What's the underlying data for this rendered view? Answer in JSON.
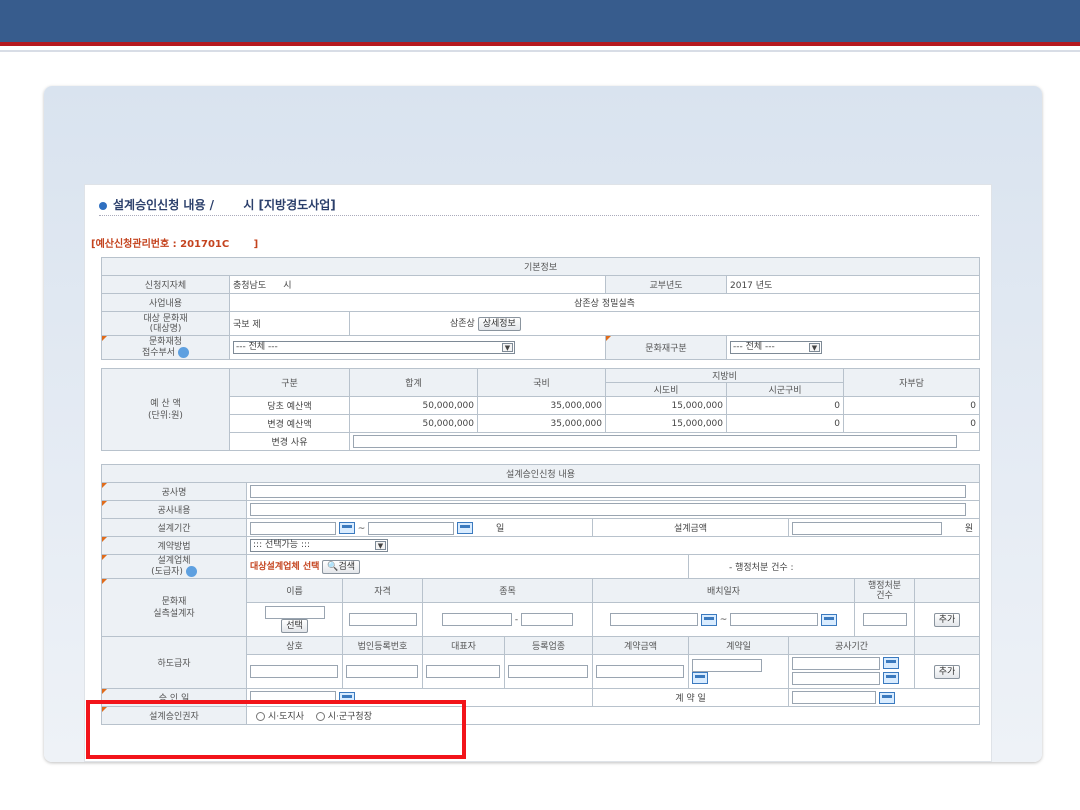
{
  "heading": {
    "title": "설계승인신청 내용 /",
    "region": "시 [지방경도사업]"
  },
  "mgmt": {
    "label": "[예산신청관리번호 : ",
    "number": "201701C",
    "close": "]"
  },
  "basic": {
    "section": "기본정보",
    "applicant_label": "신청지자체",
    "applicant_value": "충청남도",
    "applicant_city": "시",
    "year_label": "교부년도",
    "year_value": "2017 년도",
    "project_label": "사업내용",
    "project_value": "삼존상 정밀실측",
    "heritage_label": "대상 문화재\n(대상명)",
    "heritage_value": "국보 제",
    "heritage_name": "삼존상",
    "detail_button": "상세정보",
    "office_label": "문화재청\n접수부서",
    "office_select": "--- 전체 ---",
    "category_label": "문화재구분",
    "category_select": "--- 전체 ---",
    "budget_label": "예 산 액\n(단위:원)",
    "budget_headers": {
      "type": "구분",
      "total": "합계",
      "national": "국비",
      "local": "지방비",
      "provincial": "시도비",
      "city": "시군구비",
      "self": "자부담"
    },
    "budget_rows": [
      {
        "type": "당초 예산액",
        "total": "50,000,000",
        "national": "35,000,000",
        "provincial": "15,000,000",
        "city": "0",
        "self": "0"
      },
      {
        "type": "변경 예산액",
        "total": "50,000,000",
        "national": "35,000,000",
        "provincial": "15,000,000",
        "city": "0",
        "self": "0"
      }
    ],
    "change_reason_label": "변경 사유"
  },
  "design": {
    "section": "설계승인신청 내용",
    "work_name": "공사명",
    "work_content": "공사내용",
    "period_label": "설계기간",
    "period_sep": "~",
    "period_unit": "일",
    "amount_label": "설계금액",
    "amount_unit": "원",
    "contract_method": "계약방법",
    "contract_select": "::: 선택가능 :::",
    "designer_label": "설계업체\n(도급자)",
    "designer_select": "대상설계업체 선택",
    "search_button": "검색",
    "disposal_count": "- 행정처분 건수 :",
    "surveyor_label": "문화재\n실측설계자",
    "surveyor_headers": {
      "name": "이름",
      "qual": "자격",
      "type": "종목",
      "period": "배치일자",
      "disposal": "행정처분\n건수"
    },
    "select_button": "선택",
    "dash": "-",
    "tilde": "~",
    "add_button": "추가",
    "sub_label": "하도급자",
    "sub_headers": {
      "company": "상호",
      "bizno": "법인등록번호",
      "ceo": "대표자",
      "biztype": "등록업종",
      "amount": "계약금액",
      "date": "계약일",
      "period": "공사기간"
    },
    "approve_date": "승 인 일",
    "contract_date": "계 약 일",
    "authority_label": "설계승인권자",
    "authority_opt1": "시·도지사",
    "authority_opt2": "시·군구청장"
  }
}
